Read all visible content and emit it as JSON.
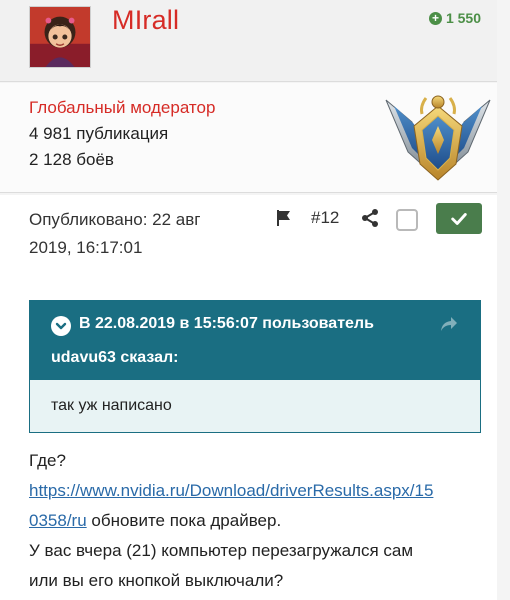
{
  "author": {
    "username": "MIrall",
    "reputation": "1 550",
    "group": "Глобальный модератор",
    "posts": "4 981 публикация",
    "battles": "2 128 боёв"
  },
  "post": {
    "published_line1": "Опубликовано: 22 авг",
    "published_line2": "2019, 16:17:01",
    "number": "#12"
  },
  "quote": {
    "header_line1": "В 22.08.2019 в 15:56:07 пользователь",
    "header_line2": "udavu63 сказал:",
    "text": "так уж написано"
  },
  "body": {
    "line1": "Где?",
    "link_part1": "https://www.nvidia.ru/Download/driverResults.aspx/15",
    "link_part2": "0358/ru",
    "after_link": " обновите пока драйвер.",
    "line3": "У вас вчера (21) компьютер перезагружался сам",
    "line4": "или вы его кнопкой выключали?"
  },
  "colors": {
    "accent_red": "#d62b26",
    "reputation_green": "#4c8f47",
    "quote_header": "#1a6e82",
    "accept_button": "#4a7d4c"
  },
  "icons": [
    "plus-circle-icon",
    "flag-icon",
    "share-icon",
    "check-icon",
    "chevron-down-icon",
    "reply-arrow-icon"
  ]
}
